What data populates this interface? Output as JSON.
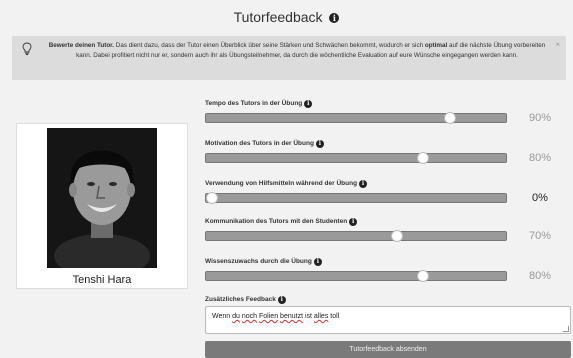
{
  "header": {
    "title": "Tutorfeedback"
  },
  "notice": {
    "lead": "Bewerte deinen Tutor.",
    "text_a": " Das dient dazu, dass der Tutor einen Überblick über seine Stärken und Schwächen bekommt, wodurch er sich ",
    "bold": "optimal",
    "text_b": " auf die nächste Übung vorbereiten kann. Dabei profitiert nicht nur er, sondern auch ihr als Übungsteilnehmer, da durch die wöchentliche Evaluation auf eure Wünsche eingegangen werden kann.",
    "close": "×"
  },
  "profile": {
    "name": "Tenshi Hara"
  },
  "ratings": [
    {
      "label": "Tempo des Tutors in der Übung",
      "value": 90,
      "display": "90%"
    },
    {
      "label": "Motivation des Tutors in der Übung",
      "value": 80,
      "display": "80%"
    },
    {
      "label": "Verwendung von Hilfsmitteln während der Übung",
      "value": 0,
      "display": "0%"
    },
    {
      "label": "Kommunikation des Tutors mit den Studenten",
      "value": 70,
      "display": "70%"
    },
    {
      "label": "Wissenszuwachs durch die Übung",
      "value": 80,
      "display": "80%"
    }
  ],
  "feedback": {
    "label": "Zusätzliches Feedback",
    "words": [
      "Wenn",
      " ",
      "du",
      " ",
      "noch",
      " ",
      "Folien",
      " ",
      "benutzt",
      " ",
      "ist",
      " ",
      "alles",
      " ",
      "toll"
    ]
  },
  "submit": {
    "label": "Tutorfeedback absenden"
  },
  "colors": {
    "track": "#9a9a9a",
    "button": "#7a7a7a",
    "notice_bg": "#dcdcdc"
  },
  "icons": {
    "info": "info-icon",
    "bulb": "lightbulb-icon",
    "close": "close-icon"
  }
}
